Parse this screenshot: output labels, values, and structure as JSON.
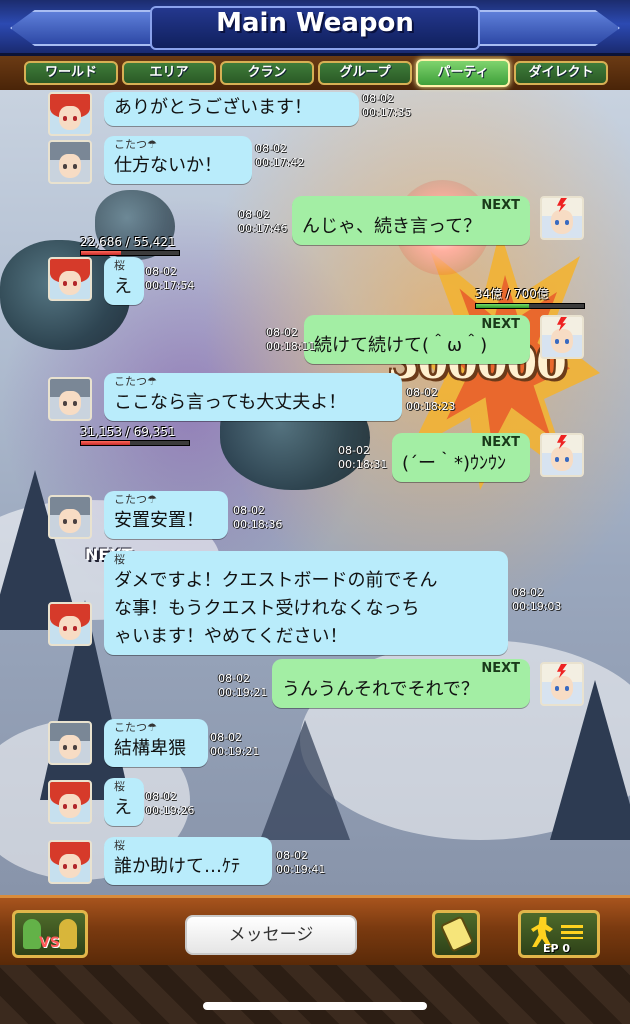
{
  "title": "Main Weapon",
  "tabs": [
    {
      "label": "ワールド",
      "active": false
    },
    {
      "label": "エリア",
      "active": false
    },
    {
      "label": "クラン",
      "active": false
    },
    {
      "label": "グループ",
      "active": false
    },
    {
      "label": "パーティ",
      "active": true
    },
    {
      "label": "ダイレクト",
      "active": false
    }
  ],
  "scene": {
    "damage": "300000",
    "boss_hp": "34億 / 700億",
    "boss_hp_fraction": 0.49,
    "ally1_hp": "22,686 / 55,421",
    "ally1_hp_fraction": 0.41,
    "ally2_hp": "31,153 / 69,351",
    "ally2_hp_fraction": 0.45,
    "next_label": "NEXT"
  },
  "messages": [
    {
      "side": "left",
      "avatar": "sakura",
      "name": "",
      "text": "ありがとうございます！",
      "date": "08-02",
      "time": "00:17:35"
    },
    {
      "side": "left",
      "avatar": "kotatsu",
      "name": "こたつ☂",
      "text": "仕方ないか！",
      "date": "08-02",
      "time": "00:17:42"
    },
    {
      "side": "right",
      "avatar": "next",
      "name": "NEXT",
      "text": "んじゃ、続き言って？",
      "date": "08-02",
      "time": "00:17:46"
    },
    {
      "side": "left",
      "avatar": "sakura",
      "name": "桜",
      "text": "え",
      "date": "08-02",
      "time": "00:17:54"
    },
    {
      "side": "right",
      "avatar": "next",
      "name": "NEXT",
      "text": "続けて続けて(＾ω＾)",
      "date": "08-02",
      "time": "00:18:11"
    },
    {
      "side": "left",
      "avatar": "kotatsu",
      "name": "こたつ☂",
      "text": "ここなら言っても大丈夫よ！",
      "date": "08-02",
      "time": "00:18:23"
    },
    {
      "side": "right",
      "avatar": "next",
      "name": "NEXT",
      "text": "(´ー｀*)ｳﾝｳﾝ",
      "date": "08-02",
      "time": "00:18:31"
    },
    {
      "side": "left",
      "avatar": "kotatsu",
      "name": "こたつ☂",
      "text": "安置安置！",
      "date": "08-02",
      "time": "00:18:36"
    },
    {
      "side": "left",
      "avatar": "sakura",
      "name": "桜",
      "lines": [
        "ダメですよ！クエストボードの前でそん",
        "な事！もうクエスト受けれなくなっち",
        "ゃいます！やめてください！"
      ],
      "date": "08-02",
      "time": "00:19:03"
    },
    {
      "side": "right",
      "avatar": "next",
      "name": "NEXT",
      "text": "うんうんそれでそれで？",
      "date": "08-02",
      "time": "00:19:21"
    },
    {
      "side": "left",
      "avatar": "kotatsu",
      "name": "こたつ☂",
      "text": "結構卑猥",
      "date": "08-02",
      "time": "00:19:21"
    },
    {
      "side": "left",
      "avatar": "sakura",
      "name": "桜",
      "text": "え",
      "date": "08-02",
      "time": "00:19:26"
    },
    {
      "side": "left",
      "avatar": "sakura",
      "name": "桜",
      "text": "誰か助けて…ｹﾃ",
      "date": "08-02",
      "time": "00:19:41"
    }
  ],
  "bottom": {
    "vs_label": "VS",
    "message_label": "メッセージ",
    "ep_label": "EP 0"
  },
  "colors": {
    "bubble_left": "#b9ecfb",
    "bubble_right": "#a3eea4",
    "tab_active": "#3fa03a",
    "title_bar": "#2c4ab2"
  },
  "icons": [
    "vs-icon",
    "stamp-icon",
    "running-man-icon"
  ]
}
